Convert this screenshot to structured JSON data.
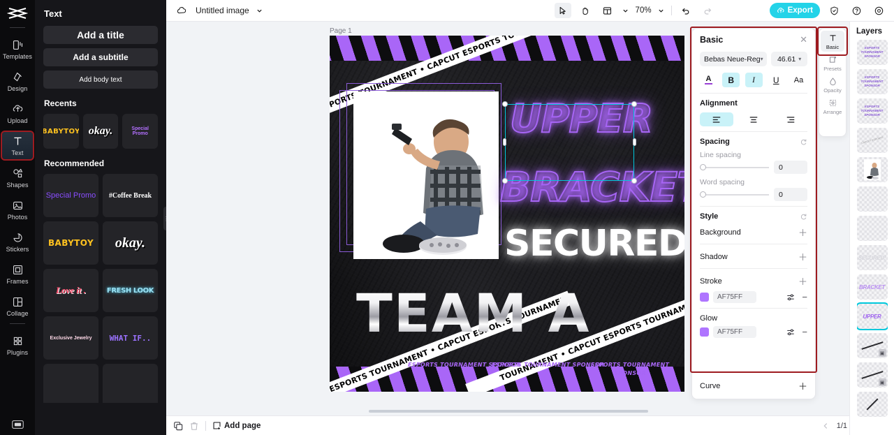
{
  "left_rail": {
    "logo_name": "capcut-logo",
    "items": [
      {
        "label": "Templates",
        "icon": "templates-icon"
      },
      {
        "label": "Design",
        "icon": "design-icon"
      },
      {
        "label": "Upload",
        "icon": "upload-icon"
      },
      {
        "label": "Text",
        "icon": "text-icon"
      },
      {
        "label": "Shapes",
        "icon": "shapes-icon"
      },
      {
        "label": "Photos",
        "icon": "photos-icon"
      },
      {
        "label": "Stickers",
        "icon": "stickers-icon"
      },
      {
        "label": "Frames",
        "icon": "frames-icon"
      },
      {
        "label": "Collage",
        "icon": "collage-icon"
      },
      {
        "label": "Plugins",
        "icon": "plugins-icon"
      }
    ],
    "bottom_icon": "keyboard-icon"
  },
  "text_panel": {
    "title": "Text",
    "buttons": [
      "Add a title",
      "Add a subtitle",
      "Add body text"
    ],
    "recents_title": "Recents",
    "recents": [
      "BABYTOY",
      "okay.",
      "Special Promo"
    ],
    "recommended_title": "Recommended",
    "recommended": [
      "Special Promo",
      "#Coffee Break",
      "BABYTOY",
      "okay.",
      "Love it .",
      "FRESH LOOK",
      "Exclusive Jewelry",
      "WHAT IF.."
    ]
  },
  "topbar": {
    "cloud_icon": "cloud-save-icon",
    "doc_title": "Untitled image",
    "title_chevron": "chevron-down-icon",
    "select_tool": "cursor-select-icon",
    "hand_tool": "hand-pan-icon",
    "layout_tool": "layout-grid-icon",
    "zoom_value": "70%",
    "undo": "undo-icon",
    "redo": "redo-icon",
    "export_label": "Export",
    "export_icon": "export-cloud-icon",
    "shield_icon": "shield-check-icon",
    "help_icon": "help-circle-icon",
    "settings_icon": "gear-icon",
    "accent_color": "#23d3e8"
  },
  "canvas": {
    "page_label": "Page 1",
    "page_tool_icons": [
      "globe-share-icon",
      "more-dots-icon"
    ],
    "float_bar_icons": [
      "duplicate-icon",
      "more-dots-icon"
    ],
    "rotate_icon": "rotate-handle-icon",
    "ribbon_text": "CAPCUT ESPORTS TOURNAMENT • CAPCUT ESPORTS TOURNAMENT •",
    "ribbon_text_2": "CAPCUT ESPORTS TOURNAMENT • CAPCUT ESPORTS TOURNAMENT",
    "ribbon_text_3": "TOURNAMENT • CAPCUT ESPORTS TOURNAMENT •",
    "headline_1": "UPPER",
    "headline_2": "BRACKET",
    "headline_3": "SECURED!",
    "headline_4": "TEAM A",
    "sponsor_text": "ESPORTS TOURNAMENT SPONSOR",
    "neon_color": "#A765FF",
    "stripe_color": "#A966F7",
    "selection_color": "#00C8DC"
  },
  "properties": {
    "title": "Basic",
    "close_icon": "close-icon",
    "font_family": "Bebas Neue-Reg",
    "font_size": "46.61",
    "format_buttons": [
      {
        "name": "text-color",
        "glyph": "A",
        "active": false
      },
      {
        "name": "bold",
        "glyph": "B",
        "active": true
      },
      {
        "name": "italic",
        "glyph": "I",
        "active": true
      },
      {
        "name": "underline",
        "glyph": "U",
        "active": false
      },
      {
        "name": "text-case",
        "glyph": "Aa",
        "active": false
      }
    ],
    "alignment_label": "Alignment",
    "alignment_options": [
      "align-left",
      "align-center",
      "align-right"
    ],
    "alignment_selected": "align-left",
    "spacing_label": "Spacing",
    "spacing_reset_icon": "reset-icon",
    "line_spacing_label": "Line spacing",
    "line_spacing_value": "0",
    "word_spacing_label": "Word spacing",
    "word_spacing_value": "0",
    "style_label": "Style",
    "style_reset_icon": "reset-icon",
    "background_label": "Background",
    "background_add_icon": "plus-icon",
    "shadow_label": "Shadow",
    "shadow_add_icon": "plus-icon",
    "stroke_label": "Stroke",
    "stroke_add_icon": "plus-icon",
    "stroke_color_hex": "AF75FF",
    "stroke_swatch": "#AF75FF",
    "stroke_settings_icon": "sliders-icon",
    "stroke_remove_icon": "minus-icon",
    "glow_label": "Glow",
    "glow_color_hex": "AF75FF",
    "glow_swatch": "#AF75FF",
    "glow_settings_icon": "sliders-icon",
    "glow_remove_icon": "minus-icon",
    "curve_label": "Curve",
    "curve_add_icon": "plus-icon",
    "highlight_color": "#9E1B20"
  },
  "tool_rail": {
    "items": [
      {
        "label": "Basic",
        "icon": "text-t-icon",
        "active": true
      },
      {
        "label": "Presets",
        "icon": "presets-icon",
        "active": false
      },
      {
        "label": "Opacity",
        "icon": "opacity-drop-icon",
        "active": false
      },
      {
        "label": "Arrange",
        "icon": "arrange-icon",
        "active": false
      }
    ]
  },
  "layers": {
    "title": "Layers",
    "items": [
      {
        "type": "text",
        "text": "ESPORTS TOURNAMENT SPONSOR",
        "selected": false
      },
      {
        "type": "text",
        "text": "ESPORTS TOURNAMENT SPONSOR",
        "selected": false
      },
      {
        "type": "text",
        "text": "ESPORTS TOURNAMENT SPONSOR",
        "selected": false
      },
      {
        "type": "ribbon",
        "text": "",
        "selected": false
      },
      {
        "type": "photo",
        "text": "",
        "selected": false
      },
      {
        "type": "empty",
        "text": "",
        "selected": false
      },
      {
        "type": "empty",
        "text": "",
        "selected": false
      },
      {
        "type": "big",
        "text": "SECURED!",
        "selected": false
      },
      {
        "type": "big",
        "text": "BRACKET",
        "selected": false
      },
      {
        "type": "big",
        "text": "UPPER",
        "selected": true
      },
      {
        "type": "line",
        "text": "",
        "selected": false
      },
      {
        "type": "line",
        "text": "",
        "selected": false
      },
      {
        "type": "line",
        "text": "",
        "selected": false
      }
    ]
  },
  "bottombar": {
    "duplicate_icon": "duplicate-page-icon",
    "delete_icon": "trash-icon",
    "add_page_label": "Add page",
    "add_page_icon": "add-page-icon",
    "prev_icon": "chevron-left-icon",
    "page_counter": "1/1",
    "next_icon": "chevron-right-icon",
    "print_icon": "print-icon"
  }
}
